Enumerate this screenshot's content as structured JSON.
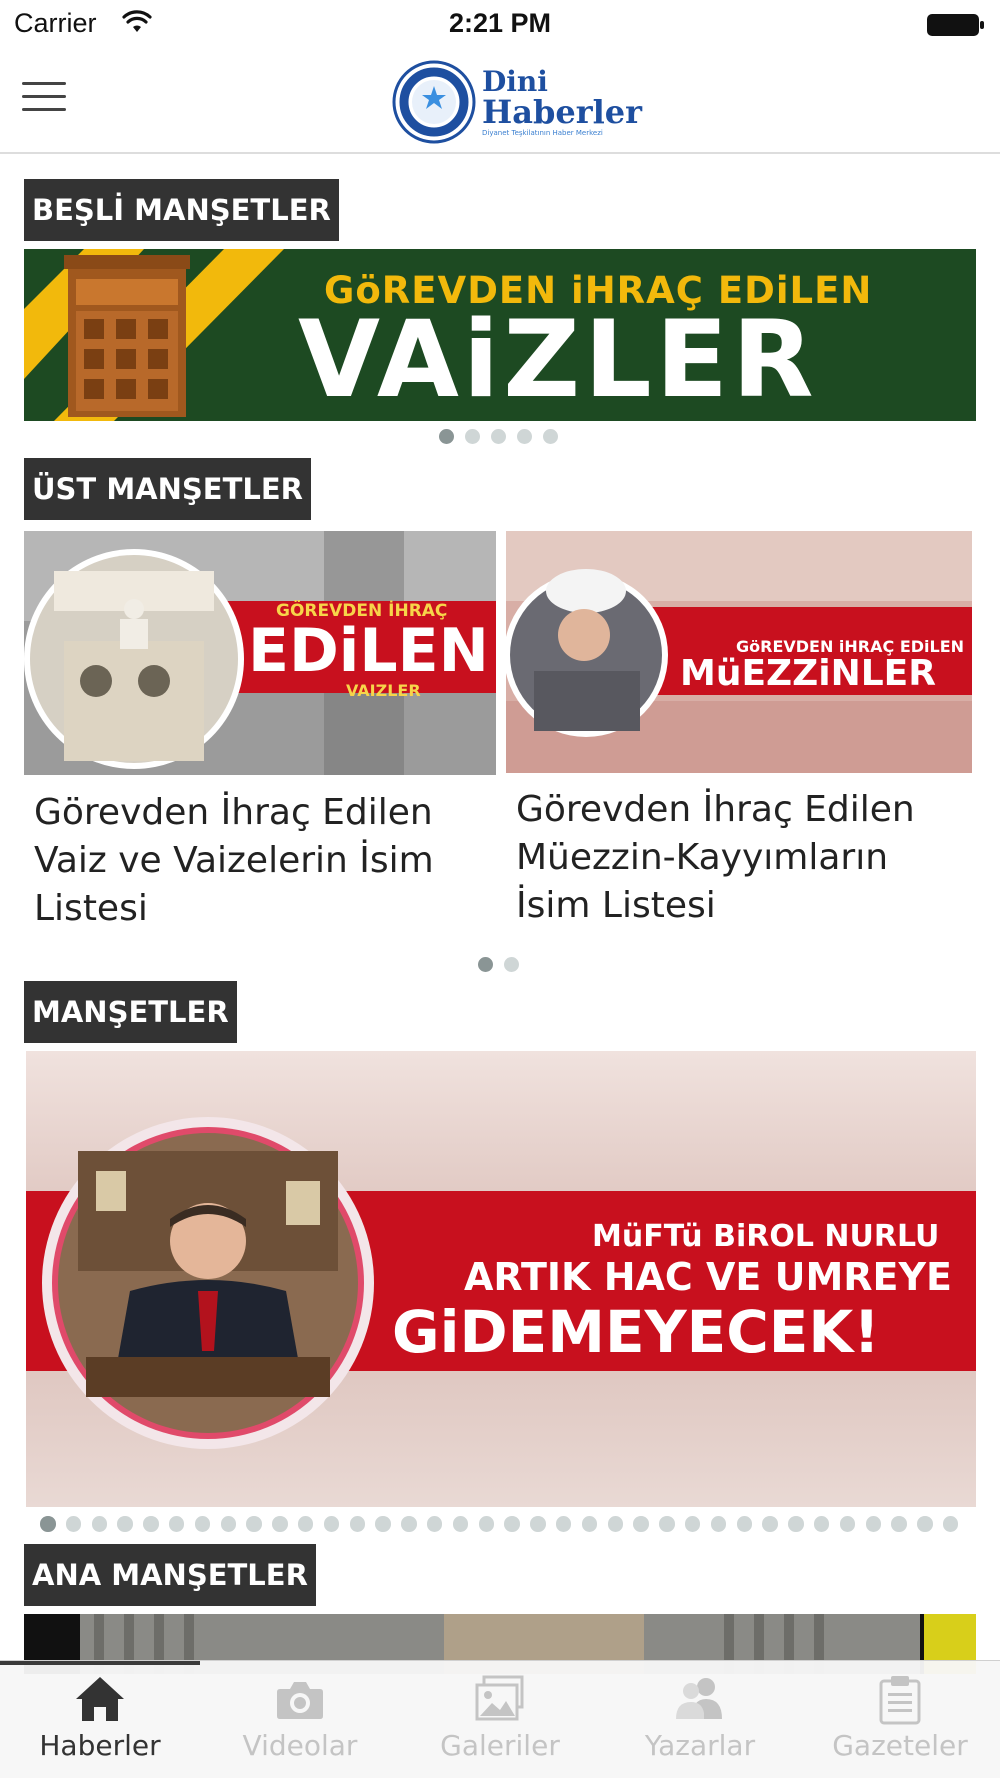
{
  "status_bar": {
    "carrier": "Carrier",
    "time": "2:21 PM"
  },
  "nav": {
    "logo_line1": "Dini",
    "logo_line2": "Haberler",
    "logo_subtitle": "Diyanet Teşkilatının Haber Merkezi"
  },
  "sections": {
    "besli": {
      "title": "BEŞLİ MANŞETLER",
      "banner_line1": "GöREVDEN iHRAÇ EDiLEN",
      "banner_line2": "VAiZLER",
      "dots_total": 5,
      "dots_active": 0
    },
    "ust": {
      "title": "ÜST MANŞETLER",
      "cards": [
        {
          "image_top": "GÖREVDEN İHRAÇ",
          "image_main": "EDiLEN",
          "image_sub": "VAIZLER",
          "title_lines": [
            "Görevden İhraç Edilen",
            "Vaiz ve Vaizelerin İsim",
            "Listesi"
          ]
        },
        {
          "image_top": "GöREVDEN iHRAÇ EDiLEN",
          "image_main": "MüEZZiNLER",
          "title_lines": [
            "Görevden İhraç Edilen",
            "Müezzin-Kayyımların",
            "İsim Listesi"
          ]
        }
      ],
      "dots_total": 2,
      "dots_active": 0
    },
    "mansetler": {
      "title": "MANŞETLER",
      "banner_line1": "MüFTü BiROL NURLU",
      "banner_line2": "ARTIK HAC VE UMREYE",
      "banner_line3": "GiDEMEYECEK!",
      "dots_total": 36,
      "dots_active": 0
    },
    "ana": {
      "title": "ANA MANŞETLER"
    }
  },
  "tab_bar": {
    "tabs": [
      {
        "label": "Haberler",
        "icon": "home-icon",
        "active": true
      },
      {
        "label": "Videolar",
        "icon": "camera-icon",
        "active": false
      },
      {
        "label": "Galeriler",
        "icon": "gallery-icon",
        "active": false
      },
      {
        "label": "Yazarlar",
        "icon": "users-icon",
        "active": false
      },
      {
        "label": "Gazeteler",
        "icon": "clipboard-icon",
        "active": false
      }
    ]
  },
  "colors": {
    "section_header_bg": "#333333",
    "banner_red": "#c8101e",
    "banner_yellow": "#f2b90c",
    "banner_green": "#1d4a22",
    "logo_blue": "#1e4fa0"
  }
}
